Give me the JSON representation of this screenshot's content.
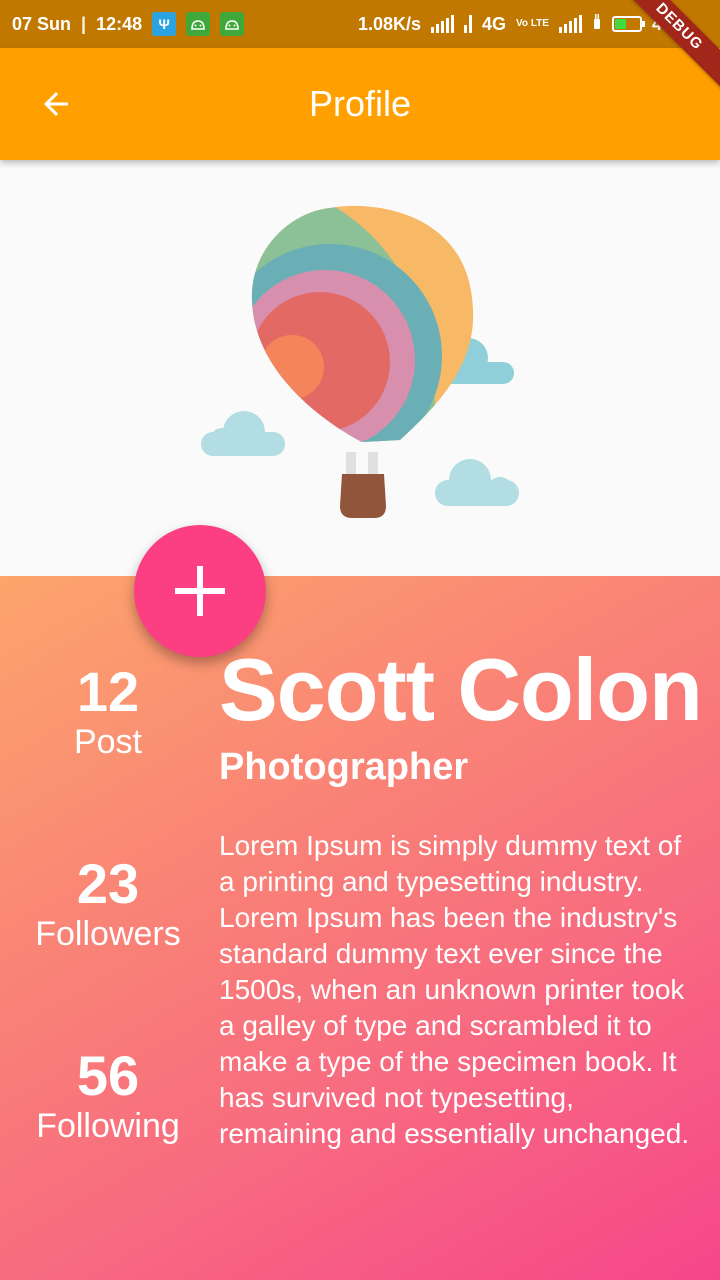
{
  "status_bar": {
    "date": "07 Sun",
    "separator": "|",
    "time": "12:48",
    "network_speed": "1.08K/s",
    "network_type": "4G",
    "volte": "Vo LTE",
    "battery_percent": "48%",
    "battery_level": 0.48
  },
  "debug_banner": "DEBUG",
  "app_bar": {
    "title": "Profile",
    "color": "#ffa000"
  },
  "profile": {
    "name": "Scott Colon",
    "role": "Photographer",
    "bio": "Lorem Ipsum is simply dummy text of a printing and typesetting industry. Lorem Ipsum has been the industry's standard dummy text ever since the 1500s, when an unknown printer took a galley of type and scrambled it to make a type of the specimen book. It has survived not typesetting, remaining and essentially unchanged."
  },
  "stats": [
    {
      "value": "12",
      "label": "Post"
    },
    {
      "value": "23",
      "label": "Followers"
    },
    {
      "value": "56",
      "label": "Following"
    }
  ],
  "fab": {
    "icon": "plus-icon",
    "color": "#fc3e83"
  },
  "hero_image": {
    "icon": "hot-air-balloon-illustration"
  }
}
